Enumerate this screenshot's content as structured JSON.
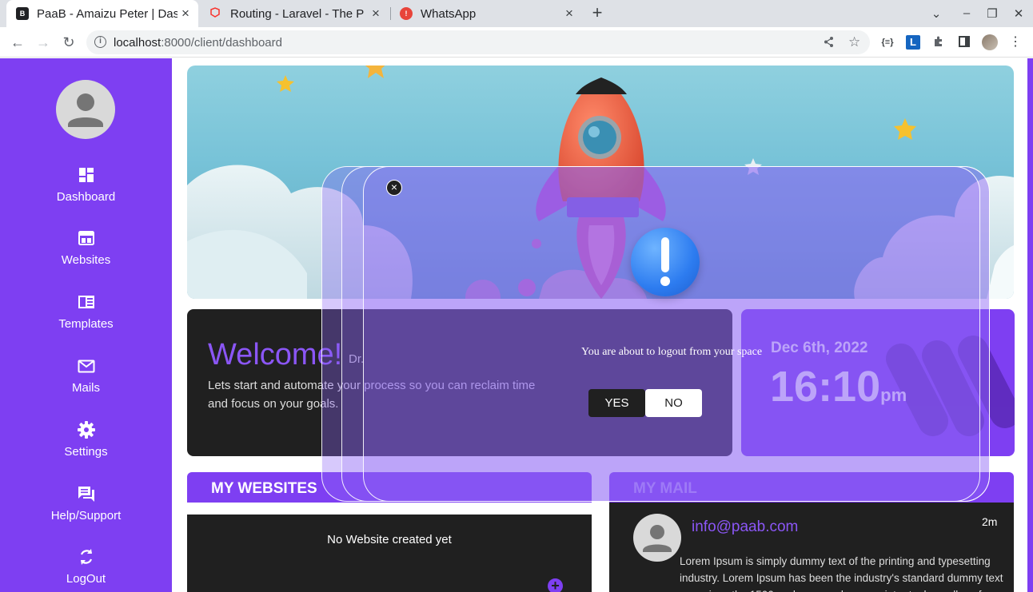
{
  "browser": {
    "tabs": [
      {
        "title": "PaaB - Amaizu Peter | Dashb",
        "favicon": "paab-favicon",
        "color": "#202124"
      },
      {
        "title": "Routing - Laravel - The PHP",
        "favicon": "laravel-favicon",
        "color": "#f9322c"
      },
      {
        "title": "WhatsApp",
        "favicon": "whatsapp-favicon",
        "color": "#e8443a"
      }
    ],
    "url_host": "localhost",
    "url_path": ":8000/client/dashboard"
  },
  "sidebar": {
    "items": [
      {
        "label": "Dashboard",
        "icon": "dashboard-icon"
      },
      {
        "label": "Websites",
        "icon": "websites-icon"
      },
      {
        "label": "Templates",
        "icon": "templates-icon"
      },
      {
        "label": "Mails",
        "icon": "mail-icon"
      },
      {
        "label": "Settings",
        "icon": "gear-icon"
      },
      {
        "label": "Help/Support",
        "icon": "chat-icon"
      },
      {
        "label": "LogOut",
        "icon": "logout-icon"
      }
    ]
  },
  "welcome": {
    "heading": "Welcome!",
    "name": "Dr.",
    "text": "Lets start and automate your process so you can reclaim time and focus on your goals."
  },
  "clock": {
    "date": "Dec 6th, 2022",
    "time": "16:10",
    "ampm": "pm"
  },
  "websites": {
    "title": "MY WEBSITES",
    "empty": "No Website created yet",
    "add": "+"
  },
  "mail": {
    "title": "MY MAIL",
    "from": "info@paab.com",
    "ago": "2m",
    "text": "Lorem Ipsum is simply dummy text of the printing and typesetting industry. Lorem Ipsum has been the industry's standard dummy text ever since the 1500s, when an unknown printer took a galley of type"
  },
  "modal": {
    "message": "You are about to logout from your space",
    "yes": "YES",
    "no": "NO",
    "close": "×"
  },
  "colors": {
    "accent": "#7e3ff2",
    "dark": "#202020"
  }
}
